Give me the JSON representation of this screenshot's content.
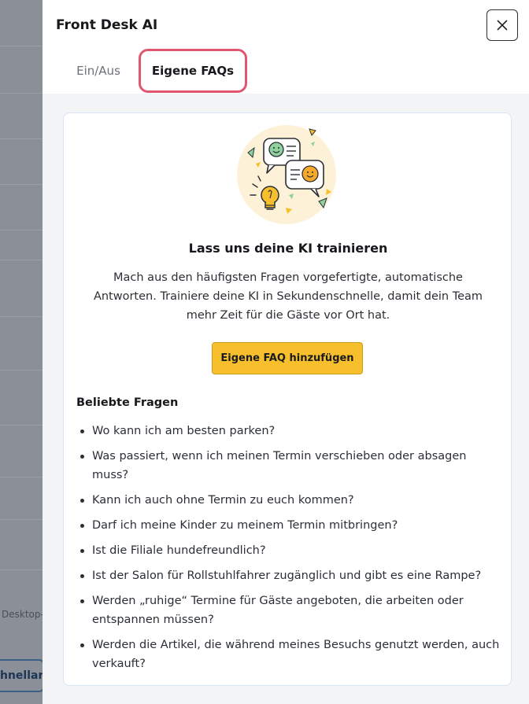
{
  "backdrop": {
    "partial_text": "Desktop-",
    "partial_button": "hnellar"
  },
  "panel": {
    "title": "Front Desk AI",
    "close_icon": "close-icon",
    "tabs": [
      {
        "label": "Ein/Aus",
        "active": false
      },
      {
        "label": "Eigene FAQs",
        "active": true
      }
    ]
  },
  "card": {
    "illustration": "chat-bubbles-lightbulb-illustration",
    "heading": "Lass uns deine KI trainieren",
    "description": "Mach aus den häufigsten Fragen vorgefertigte, automatische Antworten. Trainiere deine KI in Sekundenschnelle, damit dein Team mehr Zeit für die Gäste vor Ort hat.",
    "add_button": "Eigene FAQ hinzufügen",
    "popular_heading": "Beliebte Fragen",
    "questions": [
      "Wo kann ich am besten parken?",
      "Was passiert, wenn ich meinen Termin verschieben oder absagen muss?",
      "Kann ich auch ohne Termin zu euch kommen?",
      "Darf ich meine Kinder zu meinem Termin mitbringen?",
      "Ist die Filiale hundefreundlich?",
      "Ist der Salon für Rollstuhlfahrer zugänglich und gibt es eine Rampe?",
      "Werden „ruhige“ Termine für Gäste angeboten, die arbeiten oder entspannen müssen?",
      "Werden die Artikel, die während meines Besuchs genutzt werden, auch verkauft?"
    ]
  },
  "colors": {
    "accent_button": "#f7bf2b",
    "active_tab_border": "#e0566e",
    "card_border": "#d8e3f3",
    "panel_bg": "#f3f4f6"
  }
}
